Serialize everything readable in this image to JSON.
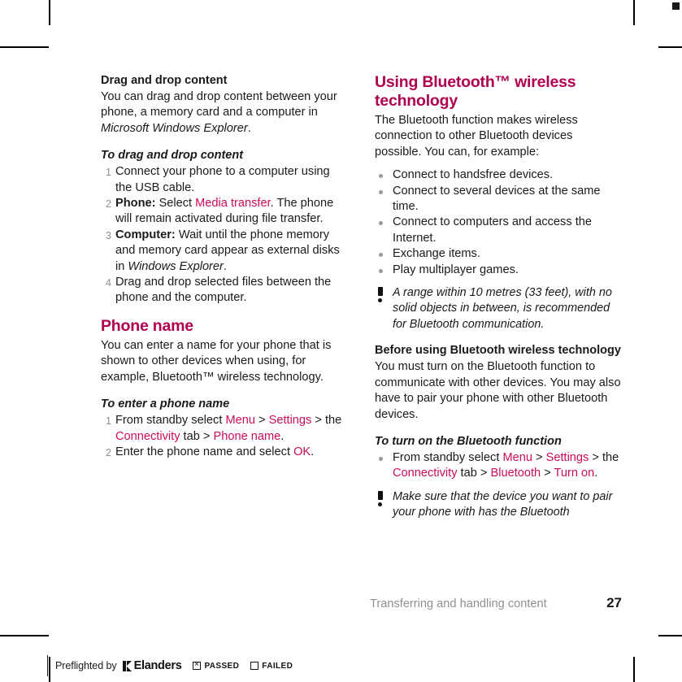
{
  "page": {
    "number": "27",
    "running_title": "Transferring and handling content"
  },
  "left_column": {
    "topic1": {
      "heading": "Drag and drop content",
      "body_parts": [
        {
          "text": "You can drag and drop content between your phone, a memory card and a computer in ",
          "style": "normal"
        },
        {
          "text": "Microsoft Windows Explorer",
          "style": "italic"
        },
        {
          "text": ".",
          "style": "normal"
        }
      ],
      "body_plain": "You can drag and drop content between your phone, a memory card and a computer in Microsoft Windows Explorer.",
      "procedure_heading": "To drag and drop content",
      "steps": [
        "Connect your phone to a computer using the USB cable.",
        "Phone: Select Media transfer. The phone will remain activated during file transfer.",
        "Computer: Wait until the phone memory and memory card appear as external disks in Windows Explorer.",
        "Drag and drop selected files between the phone and the computer."
      ]
    },
    "topic2": {
      "heading": "Phone name",
      "body_plain": "You can enter a name for your phone that is shown to other devices when using, for example, Bluetooth™ wireless technology.",
      "procedure_heading": "To enter a phone name",
      "steps": [
        "From standby select Menu > Settings > the Connectivity tab > Phone name.",
        "Enter the phone name and select OK."
      ]
    }
  },
  "right_column": {
    "heading": "Using Bluetooth™ wireless technology",
    "intro": "The Bluetooth function makes wireless connection to other Bluetooth devices possible. You can, for example:",
    "bullets": [
      "Connect to handsfree devices.",
      "Connect to several devices at the same time.",
      "Connect to computers and access the Internet.",
      "Exchange items.",
      "Play multiplayer games."
    ],
    "note1": "A range within 10 metres (33 feet), with no solid objects in between, is recommended for Bluetooth communication.",
    "subheading": "Before using Bluetooth wireless technology",
    "body": "You must turn on the Bluetooth function to communicate with other devices. You may also have to pair your phone with other Bluetooth devices.",
    "procedure_heading": "To turn on the Bluetooth function",
    "procedure_step": "From standby select Menu > Settings > the Connectivity tab > Bluetooth > Turn on.",
    "note2": "Make sure that the device you want to pair your phone with has the Bluetooth"
  },
  "ui_terms": {
    "media_transfer": "Media transfer",
    "menu": "Menu",
    "settings": "Settings",
    "connectivity": "Connectivity",
    "phone_name": "Phone name",
    "ok": "OK",
    "bluetooth": "Bluetooth",
    "turn_on": "Turn on"
  },
  "step_labels": {
    "phone": "Phone:",
    "computer": "Computer:"
  },
  "italic_terms": {
    "microsoft_windows_explorer": "Microsoft Windows Explorer",
    "windows_explorer": "Windows Explorer"
  },
  "preflight": {
    "prefix": "Preflighted by",
    "company": "Elanders",
    "passed_label": "PASSED",
    "failed_label": "FAILED"
  },
  "colors": {
    "heading_magenta": "#b00050",
    "ui_term_magenta": "#cc0b5c",
    "body_text": "#1a1a1a",
    "muted": "#8f8f8f"
  }
}
